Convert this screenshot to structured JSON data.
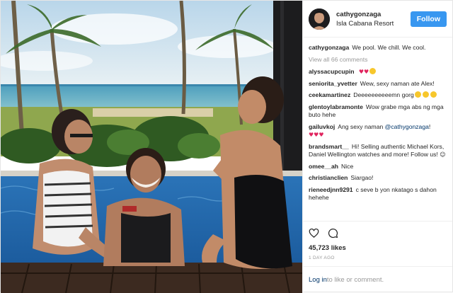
{
  "post": {
    "username": "cathygonzaga",
    "location": "Isla Cabana Resort",
    "follow_label": "Follow",
    "caption": {
      "user": "cathygonzaga",
      "text": "We pool. We chill. We cool."
    },
    "view_all": "View all 66 comments",
    "comments": [
      {
        "user": "alyssacupcupin",
        "text": "",
        "emoji": [
          "heart",
          "heart",
          "heart-eyes"
        ]
      },
      {
        "user": "seniorita_yvetter",
        "text": "Wew, sexy naman ate Alex!"
      },
      {
        "user": "ceekamartinez",
        "text": "Deeeeeeeeeemn gorg",
        "emoji": [
          "heart-eyes",
          "heart-eyes",
          "heart-eyes"
        ]
      },
      {
        "user": "glentoylabramonte",
        "text": "Wow grabe mga abs ng mga buto hehe"
      },
      {
        "user": "gailuvkoj",
        "text": "Ang sexy naman",
        "mention": "@cathygonzaga",
        "suffix": "!",
        "emoji": [
          "red-heart",
          "red-heart",
          "red-heart"
        ]
      },
      {
        "user": "brandsmart__",
        "text": "Hi! Selling authentic Michael Kors, Daniel Wellington watches and more! Follow us!",
        "emoji": [
          "smile"
        ]
      },
      {
        "user": "omee__ah",
        "text": "Nice"
      },
      {
        "user": "christianclien",
        "text": "Siargao!"
      },
      {
        "user": "rieneedjnn9291",
        "text": "c seve b yon nkatago s dahon hehehe"
      }
    ],
    "likes": "45,723 likes",
    "timestamp": "1 DAY AGO",
    "login_link": "Log in",
    "login_suffix": " to like or comment."
  },
  "icons": {
    "like": "heart-outline-icon",
    "comment": "speech-bubble-icon"
  },
  "colors": {
    "follow_button": "#3897f0",
    "link": "#003569",
    "muted": "#999999",
    "heart": "#e0245e"
  }
}
